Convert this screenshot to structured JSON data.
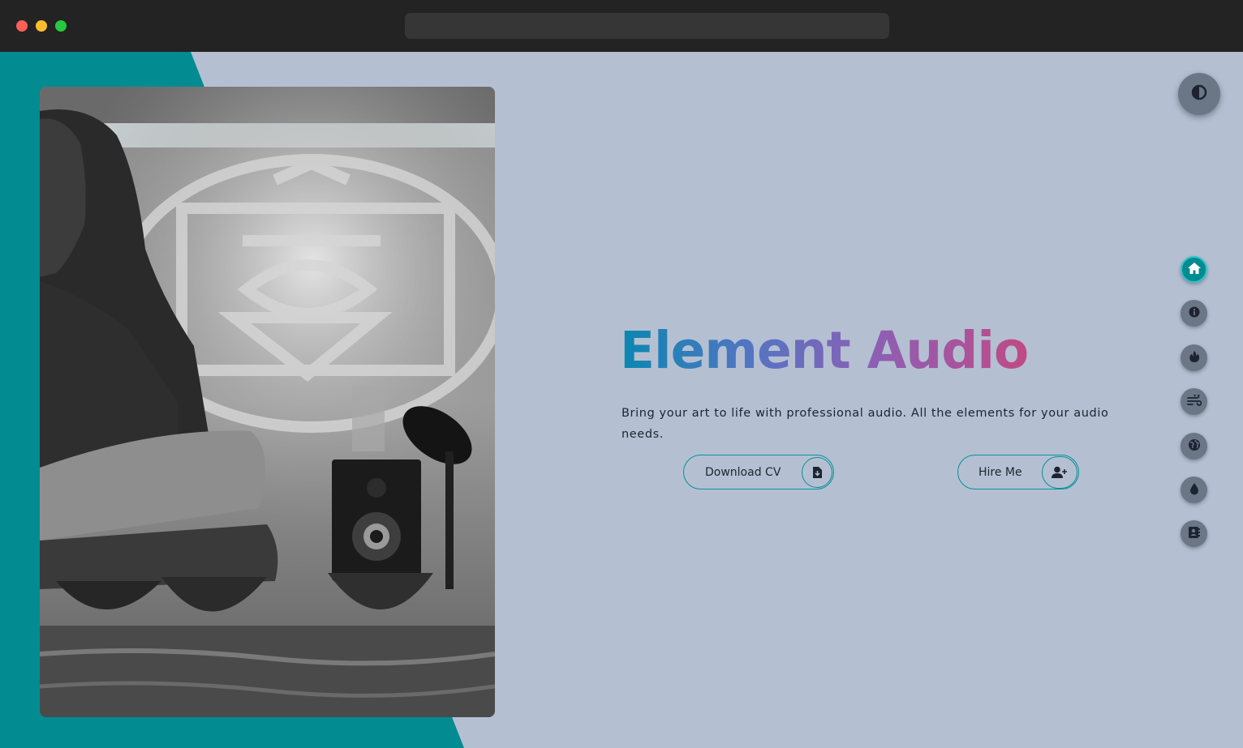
{
  "hero": {
    "title": "Element Audio",
    "subtitle": "Bring your art to life with professional audio. All the elements for your audio needs."
  },
  "buttons": {
    "download_cv": "Download CV",
    "hire_me": "Hire Me"
  },
  "side_nav": {
    "items": [
      {
        "icon": "home-icon",
        "active": true
      },
      {
        "icon": "info-icon",
        "active": false
      },
      {
        "icon": "fire-icon",
        "active": false
      },
      {
        "icon": "wind-icon",
        "active": false
      },
      {
        "icon": "earth-icon",
        "active": false
      },
      {
        "icon": "water-drop-icon",
        "active": false
      },
      {
        "icon": "contact-book-icon",
        "active": false
      }
    ]
  },
  "colors": {
    "teal": "#038b92",
    "page_background": "#b4c0d2",
    "button_gray": "#6b7686",
    "title_gradient": [
      "#0a87b0",
      "#5375c2",
      "#8c5fb5",
      "#c04a86"
    ]
  }
}
